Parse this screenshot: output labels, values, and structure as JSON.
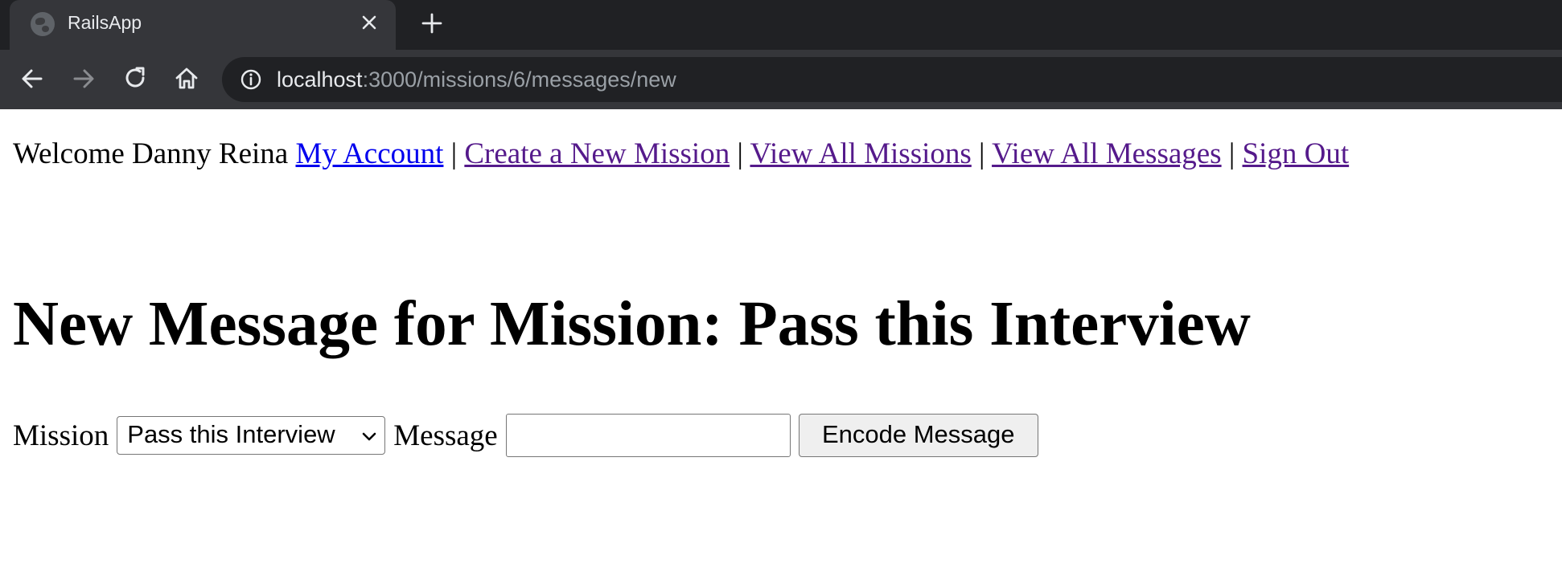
{
  "browser": {
    "tab_title": "RailsApp",
    "url_host": "localhost",
    "url_path": ":3000/missions/6/messages/new"
  },
  "nav": {
    "welcome": "Welcome Danny Reina",
    "separator": "|",
    "links": [
      {
        "label": "My Account"
      },
      {
        "label": "Create a New Mission"
      },
      {
        "label": "View All Missions"
      },
      {
        "label": "View All Messages"
      },
      {
        "label": "Sign Out"
      }
    ]
  },
  "page": {
    "heading": "New Message for Mission: Pass this Interview"
  },
  "form": {
    "mission_label": "Mission",
    "mission_selected": "Pass this Interview",
    "message_label": "Message",
    "message_value": "",
    "submit_label": "Encode Message"
  },
  "colors": {
    "chrome_dark": "#202124",
    "chrome_tab": "#35363a",
    "link_visited": "#551a8b",
    "link_unvisited": "#0000ee"
  }
}
